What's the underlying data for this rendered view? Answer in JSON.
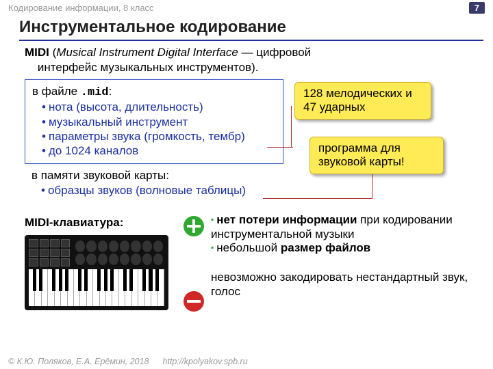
{
  "header": {
    "topic": "Кодирование информации, 8 класс",
    "page": "7"
  },
  "title": "Инструментальное кодирование",
  "intro": {
    "abbr": "MIDI",
    "expansion": "Musical Instrument Digital Interface",
    "dash": " — цифровой",
    "line2": "интерфейс музыкальных инструментов)."
  },
  "filebox": {
    "lead": "в файле ",
    "ext": ".mid",
    "colon": ":",
    "items": [
      "нота (высота, длительность)",
      "музыкальный инструмент",
      "параметры звука (громкость, тембр)",
      "до 1024 каналов"
    ]
  },
  "callout1": {
    "l1": "128 мелодических и",
    "l2": "47 ударных"
  },
  "callout2": {
    "l1": "программа для",
    "l2": "звуковой карты!"
  },
  "memory": {
    "lead": "в памяти звуковой карты:",
    "item": "образцы звуков (волновые таблицы)"
  },
  "kb_label": "MIDI-клавиатура:",
  "pros": {
    "p1a": "нет потери информации",
    "p1b": " при кодировании инструментальной музыки",
    "p2a": "небольшой ",
    "p2b": "размер файлов",
    "con": "невозможно закодировать нестандартный звук, голос"
  },
  "footer": {
    "authors": "© К.Ю. Поляков, Е.А. Ерёмин, 2018",
    "url": "http://kpolyakov.spb.ru"
  }
}
